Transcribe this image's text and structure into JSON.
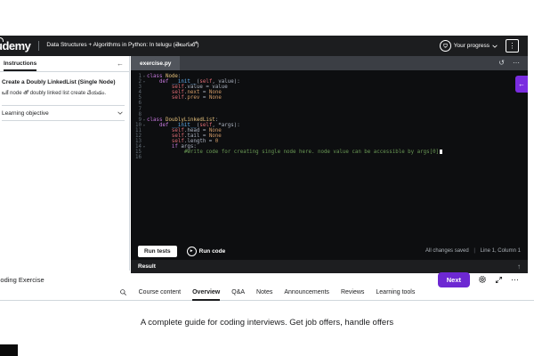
{
  "colors": {
    "accent_purple": "#6d28d2",
    "assistant_purple": "#7a2ce0",
    "header_bg": "#1c1d1f",
    "editor_bg": "#0d0e10",
    "tab_strip_bg": "#3b3e44",
    "result_bar_bg": "#1d1e20"
  },
  "header": {
    "logo": "udemy",
    "breadcrumb": "Data Structures + Algorithms in Python: In telugu (తెలుగులో)",
    "progress_label": "Your progress"
  },
  "icons": {
    "kebab_glyph": "⋮",
    "collapse_glyph": "←",
    "reset_glyph": "↺",
    "more_glyph": "⋯",
    "assistant_glyph": "←",
    "play_glyph": "▸",
    "result_toggle_glyph": "↑",
    "ellipsis_glyph": "⋯"
  },
  "instructions": {
    "tab": "Instructions",
    "title": "Create a Doubly LinkedList (Single Node)",
    "description": "ఒకే node తో doubly linked list create చేయడం.",
    "sections": [
      {
        "label": "Learning objective"
      }
    ]
  },
  "editor": {
    "file_tab": "exercise.py",
    "run_tests": "Run tests",
    "run_code": "Run code",
    "saved_status": "All changes saved",
    "cursor_status": "Line 1, Column 1",
    "lines": [
      {
        "n": 1,
        "fold": true,
        "toks": [
          [
            "k",
            "class "
          ],
          [
            "cls",
            "Node"
          ],
          [
            "d",
            ":"
          ]
        ]
      },
      {
        "n": 2,
        "fold": true,
        "toks": [
          [
            "d",
            "    "
          ],
          [
            "k",
            "def "
          ],
          [
            "fn",
            "__init__"
          ],
          [
            "d",
            "("
          ],
          [
            "sf",
            "self"
          ],
          [
            "d",
            ", value):"
          ]
        ]
      },
      {
        "n": 3,
        "toks": [
          [
            "d",
            "        "
          ],
          [
            "sf",
            "self"
          ],
          [
            "d",
            ".value = value"
          ]
        ]
      },
      {
        "n": 4,
        "toks": [
          [
            "d",
            "        "
          ],
          [
            "sf",
            "self"
          ],
          [
            "d",
            "."
          ],
          [
            "o",
            "next"
          ],
          [
            "d",
            " = "
          ],
          [
            "o",
            "None"
          ]
        ]
      },
      {
        "n": 5,
        "toks": [
          [
            "d",
            "        "
          ],
          [
            "sf",
            "self"
          ],
          [
            "d",
            "."
          ],
          [
            "o",
            "prev"
          ],
          [
            "d",
            " = "
          ],
          [
            "o",
            "None"
          ]
        ]
      },
      {
        "n": 6,
        "toks": []
      },
      {
        "n": 7,
        "toks": []
      },
      {
        "n": 8,
        "toks": []
      },
      {
        "n": 9,
        "fold": true,
        "toks": [
          [
            "k",
            "class "
          ],
          [
            "cls",
            "DoublyLinkedList"
          ],
          [
            "d",
            ":"
          ]
        ]
      },
      {
        "n": 10,
        "fold": true,
        "toks": [
          [
            "d",
            "    "
          ],
          [
            "k",
            "def "
          ],
          [
            "fn",
            "__init__"
          ],
          [
            "d",
            "("
          ],
          [
            "sf",
            "self"
          ],
          [
            "d",
            ", *args):"
          ]
        ]
      },
      {
        "n": 11,
        "toks": [
          [
            "d",
            "        "
          ],
          [
            "sf",
            "self"
          ],
          [
            "d",
            ".head = "
          ],
          [
            "o",
            "None"
          ]
        ]
      },
      {
        "n": 12,
        "toks": [
          [
            "d",
            "        "
          ],
          [
            "sf",
            "self"
          ],
          [
            "d",
            ".tail = "
          ],
          [
            "o",
            "None"
          ]
        ]
      },
      {
        "n": 13,
        "toks": [
          [
            "d",
            "        "
          ],
          [
            "sf",
            "self"
          ],
          [
            "d",
            ".length = "
          ],
          [
            "o",
            "0"
          ]
        ]
      },
      {
        "n": 14,
        "fold": true,
        "toks": [
          [
            "d",
            "        "
          ],
          [
            "k",
            "if"
          ],
          [
            "d",
            " args:"
          ]
        ]
      },
      {
        "n": 15,
        "cursor": true,
        "toks": [
          [
            "d",
            "            "
          ],
          [
            "c",
            "#Write code for creating single node here. node value can be accessible by args[0]"
          ]
        ]
      },
      {
        "n": 16,
        "toks": []
      }
    ]
  },
  "result": {
    "label": "Result"
  },
  "footer": {
    "title": "Coding Exercise",
    "next": "Next",
    "tabs": [
      "Course content",
      "Overview",
      "Q&A",
      "Notes",
      "Announcements",
      "Reviews",
      "Learning tools"
    ],
    "active_tab": "Overview",
    "tagline": "A complete guide for coding interviews. Get job offers, handle offers"
  }
}
